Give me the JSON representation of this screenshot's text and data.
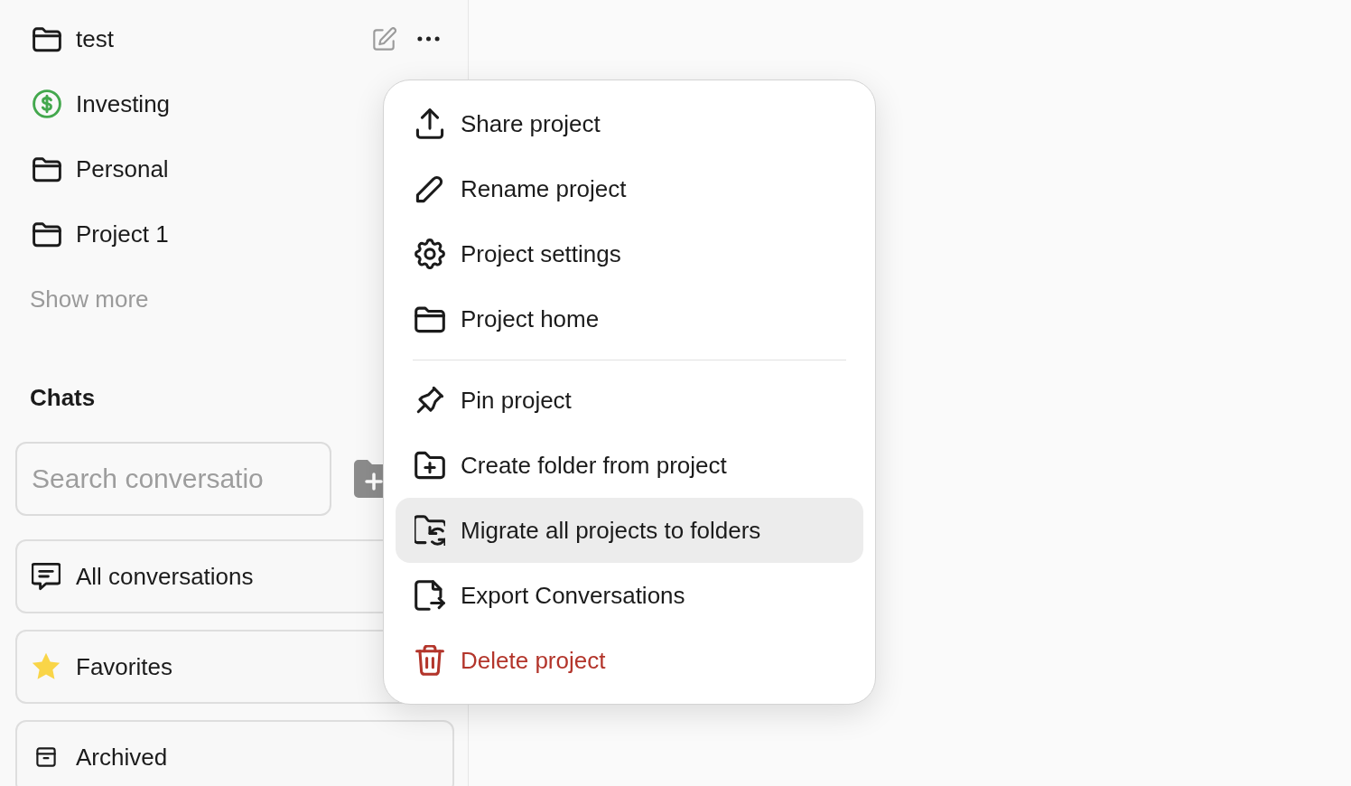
{
  "projects": {
    "items": [
      {
        "name": "test",
        "kind": "folder",
        "actions_visible": true
      },
      {
        "name": "Investing",
        "kind": "dollar",
        "actions_visible": false
      },
      {
        "name": "Personal",
        "kind": "folder",
        "actions_visible": false
      },
      {
        "name": "Project 1",
        "kind": "folder",
        "actions_visible": false
      }
    ],
    "show_more": "Show more"
  },
  "chats": {
    "title": "Chats",
    "search": {
      "placeholder": "Search conversatio"
    },
    "views": [
      {
        "label": "All conversations",
        "kind": "chats"
      },
      {
        "label": "Favorites",
        "kind": "star"
      },
      {
        "label": "Archived",
        "kind": "archive"
      }
    ]
  },
  "menu": {
    "sections": [
      {
        "items": [
          {
            "label": "Share project",
            "kind": "share",
            "highlighted": false,
            "danger": false
          },
          {
            "label": "Rename project",
            "kind": "rename",
            "highlighted": false,
            "danger": false
          },
          {
            "label": "Project settings",
            "kind": "settings",
            "highlighted": false,
            "danger": false
          },
          {
            "label": "Project home",
            "kind": "folder",
            "highlighted": false,
            "danger": false
          }
        ]
      },
      {
        "items": [
          {
            "label": "Pin project",
            "kind": "pin",
            "highlighted": false,
            "danger": false
          },
          {
            "label": "Create folder from project",
            "kind": "folder_plus",
            "highlighted": false,
            "danger": false
          },
          {
            "label": "Migrate all projects to folders",
            "kind": "folder_sync",
            "highlighted": true,
            "danger": false
          },
          {
            "label": "Export Conversations",
            "kind": "export",
            "highlighted": false,
            "danger": false
          },
          {
            "label": "Delete project",
            "kind": "delete",
            "highlighted": false,
            "danger": true
          }
        ]
      }
    ]
  }
}
